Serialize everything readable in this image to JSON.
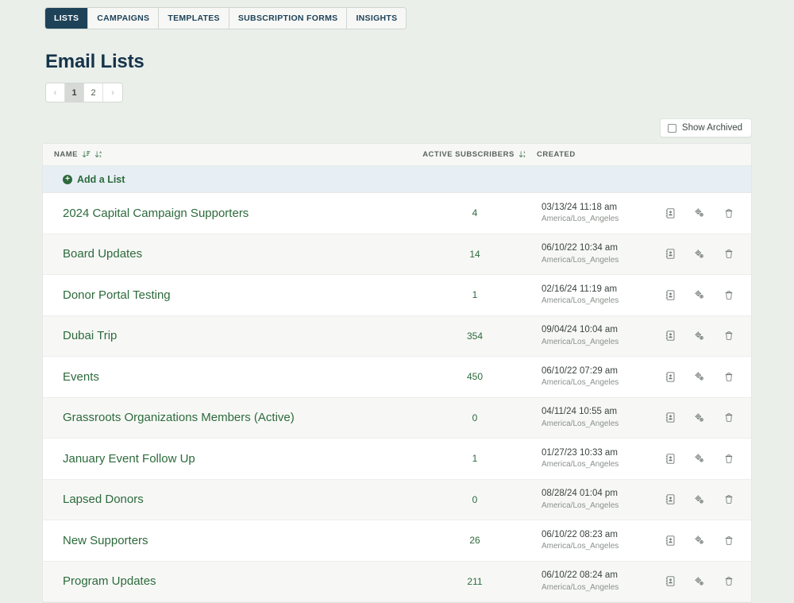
{
  "tabs": [
    {
      "label": "LISTS",
      "active": true
    },
    {
      "label": "CAMPAIGNS",
      "active": false
    },
    {
      "label": "TEMPLATES",
      "active": false
    },
    {
      "label": "SUBSCRIPTION FORMS",
      "active": false
    },
    {
      "label": "INSIGHTS",
      "active": false
    }
  ],
  "page": {
    "title": "Email Lists"
  },
  "pagination": {
    "prev_label": "‹",
    "next_label": "›",
    "pages": [
      "1",
      "2"
    ],
    "current": "1"
  },
  "toolbar": {
    "show_archived_label": "Show Archived",
    "show_archived_checked": false,
    "checkbox_icon": "checkbox-unchecked-icon"
  },
  "table": {
    "columns": {
      "name": "NAME",
      "active_subscribers": "ACTIVE SUBSCRIBERS",
      "created": "CREATED"
    },
    "sort_icons": {
      "name_sort_1": "sort-amount-icon",
      "name_sort_2": "sort-alpha-icon",
      "subscribers_sort": "sort-numeric-icon"
    },
    "add_row": {
      "label": "Add a List",
      "icon": "plus-circle-icon"
    },
    "row_actions": [
      {
        "name": "contacts-icon",
        "title": "Contacts"
      },
      {
        "name": "settings-cogs-icon",
        "title": "Settings"
      },
      {
        "name": "trash-icon",
        "title": "Delete"
      }
    ],
    "rows": [
      {
        "name": "2024 Capital Campaign Supporters",
        "subscribers": "4",
        "created_date": "03/13/24 11:18 am",
        "timezone": "America/Los_Angeles"
      },
      {
        "name": "Board Updates",
        "subscribers": "14",
        "created_date": "06/10/22 10:34 am",
        "timezone": "America/Los_Angeles"
      },
      {
        "name": "Donor Portal Testing",
        "subscribers": "1",
        "created_date": "02/16/24 11:19 am",
        "timezone": "America/Los_Angeles"
      },
      {
        "name": "Dubai Trip",
        "subscribers": "354",
        "created_date": "09/04/24 10:04 am",
        "timezone": "America/Los_Angeles"
      },
      {
        "name": "Events",
        "subscribers": "450",
        "created_date": "06/10/22 07:29 am",
        "timezone": "America/Los_Angeles"
      },
      {
        "name": "Grassroots Organizations Members (Active)",
        "subscribers": "0",
        "created_date": "04/11/24 10:55 am",
        "timezone": "America/Los_Angeles"
      },
      {
        "name": "January Event Follow Up",
        "subscribers": "1",
        "created_date": "01/27/23 10:33 am",
        "timezone": "America/Los_Angeles"
      },
      {
        "name": "Lapsed Donors",
        "subscribers": "0",
        "created_date": "08/28/24 01:04 pm",
        "timezone": "America/Los_Angeles"
      },
      {
        "name": "New Supporters",
        "subscribers": "26",
        "created_date": "06/10/22 08:23 am",
        "timezone": "America/Los_Angeles"
      },
      {
        "name": "Program Updates",
        "subscribers": "211",
        "created_date": "06/10/22 08:24 am",
        "timezone": "America/Los_Angeles"
      }
    ]
  },
  "colors": {
    "page_background": "#eaefea",
    "tab_active_background": "#1e4258",
    "title": "#16344a",
    "link_green": "#2d6a3c",
    "add_row_background": "#e7eff5",
    "row_alt_background": "#f7f8f6"
  }
}
